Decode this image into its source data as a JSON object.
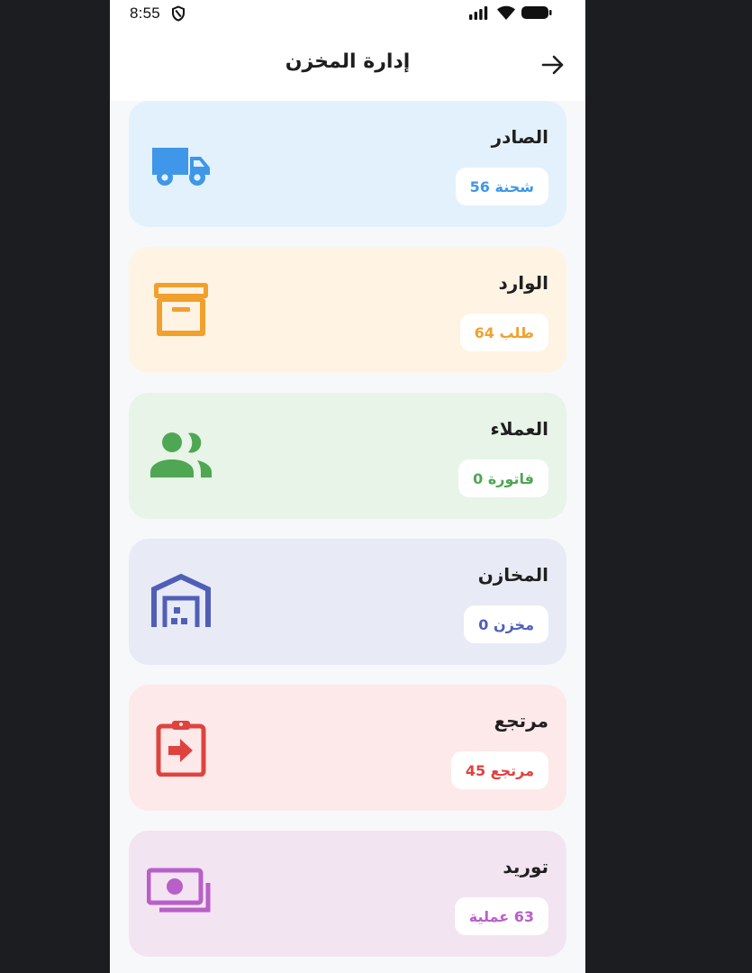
{
  "status_bar": {
    "time": "8:55",
    "icons": [
      "shield-icon",
      "signal-icon",
      "wifi-icon",
      "battery-icon"
    ]
  },
  "header": {
    "title": "إدارة المخزن",
    "back_icon": "arrow-icon"
  },
  "cards": [
    {
      "title": "الصادر",
      "badge": "شحنة 56",
      "icon": "truck-icon",
      "accent": "#3e97e8",
      "background": "#e3f1fc"
    },
    {
      "title": "الوارد",
      "badge": "طلب 64",
      "icon": "archive-box-icon",
      "accent": "#f1a02c",
      "background": "#fff3e3"
    },
    {
      "title": "العملاء",
      "badge": "فاتورة 0",
      "icon": "people-icon",
      "accent": "#4fa653",
      "background": "#e7f4e7"
    },
    {
      "title": "المخازن",
      "badge": "مخزن 0",
      "icon": "warehouse-icon",
      "accent": "#4f5fb8",
      "background": "#e8eaf6"
    },
    {
      "title": "مرتجع",
      "badge": "مرتجع 45",
      "icon": "clipboard-return-icon",
      "accent": "#e0423e",
      "background": "#fde9ea"
    },
    {
      "title": "توريد",
      "badge": "63 عملية",
      "icon": "money-icon",
      "accent": "#b95fc9",
      "background": "#f3e4f2"
    }
  ]
}
